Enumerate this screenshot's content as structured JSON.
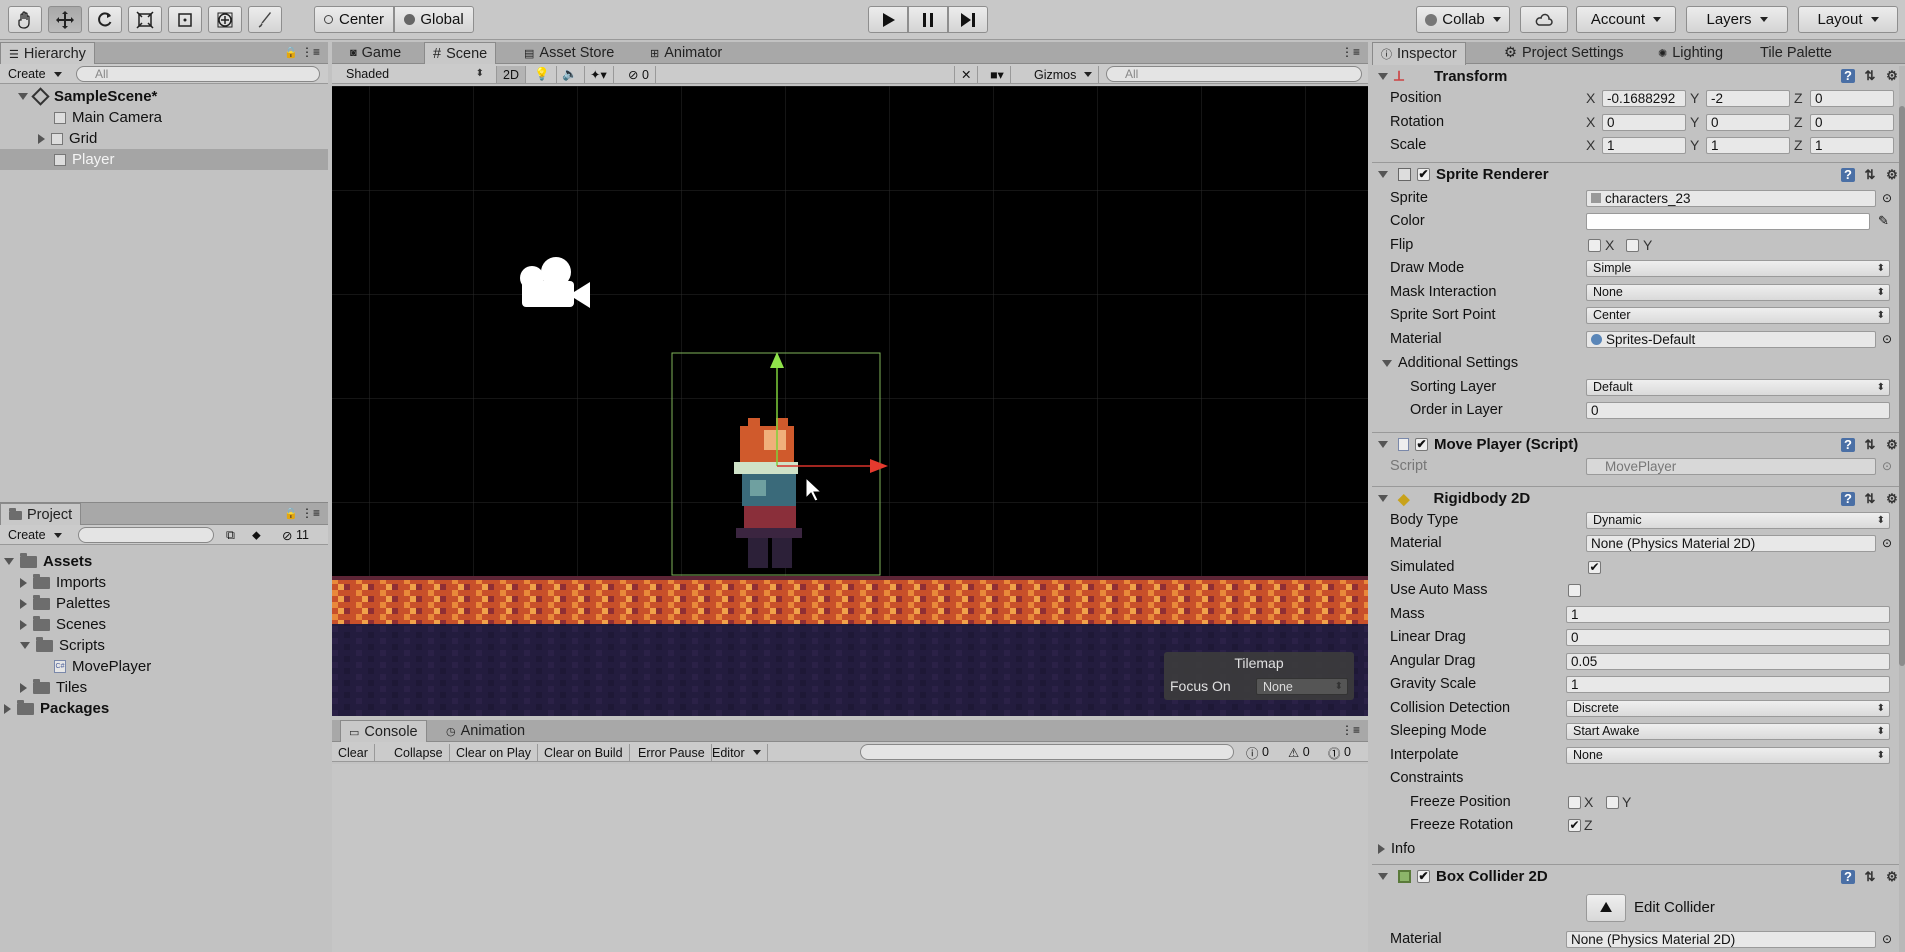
{
  "toolbar": {
    "center_label": "Center",
    "global_label": "Global",
    "collab_label": "Collab",
    "account_label": "Account",
    "layers_label": "Layers",
    "layout_label": "Layout"
  },
  "hierarchy": {
    "tab": "Hierarchy",
    "create": "Create",
    "search_placeholder": "All",
    "scene": "SampleScene*",
    "items": [
      "Main Camera",
      "Grid",
      "Player"
    ]
  },
  "scene_tabs": [
    "Game",
    "Scene",
    "Asset Store",
    "Animator"
  ],
  "scene_toolbar": {
    "shading": "Shaded",
    "mode2d": "2D",
    "hidden_count": "0",
    "gizmos": "Gizmos",
    "search_placeholder": "All"
  },
  "tilemap_overlay": {
    "title": "Tilemap",
    "focus_label": "Focus On",
    "focus_value": "None"
  },
  "project": {
    "tab": "Project",
    "create": "Create",
    "count": "11",
    "root": "Assets",
    "folders": [
      "Imports",
      "Palettes",
      "Scenes",
      "Scripts"
    ],
    "script_file": "MovePlayer",
    "tiles": "Tiles",
    "packages": "Packages"
  },
  "console": {
    "tabs": [
      "Console",
      "Animation"
    ],
    "buttons": [
      "Clear",
      "Collapse",
      "Clear on Play",
      "Clear on Build",
      "Error Pause",
      "Editor"
    ],
    "info_count": "0",
    "warn_count": "0",
    "error_count": "0"
  },
  "inspector": {
    "tabs": [
      "Inspector",
      "Project Settings",
      "Lighting",
      "Tile Palette"
    ],
    "transform": {
      "title": "Transform",
      "position_label": "Position",
      "rotation_label": "Rotation",
      "scale_label": "Scale",
      "position": [
        "-0.1688292",
        "-2",
        "0"
      ],
      "rotation": [
        "0",
        "0",
        "0"
      ],
      "scale": [
        "1",
        "1",
        "1"
      ],
      "axes": [
        "X",
        "Y",
        "Z"
      ]
    },
    "sprite_renderer": {
      "title": "Sprite Renderer",
      "sprite_label": "Sprite",
      "sprite_value": "characters_23",
      "color_label": "Color",
      "flip_label": "Flip",
      "flip_x": "X",
      "flip_y": "Y",
      "draw_mode_label": "Draw Mode",
      "draw_mode": "Simple",
      "mask_label": "Mask Interaction",
      "mask": "None",
      "sort_point_label": "Sprite Sort Point",
      "sort_point": "Center",
      "material_label": "Material",
      "material": "Sprites-Default",
      "additional_label": "Additional Settings",
      "sorting_layer_label": "Sorting Layer",
      "sorting_layer": "Default",
      "order_label": "Order in Layer",
      "order": "0"
    },
    "move_player": {
      "title": "Move Player (Script)",
      "script_label": "Script",
      "script_value": "MovePlayer"
    },
    "rigidbody": {
      "title": "Rigidbody 2D",
      "body_type_label": "Body Type",
      "body_type": "Dynamic",
      "material_label": "Material",
      "material": "None (Physics Material 2D)",
      "simulated_label": "Simulated",
      "auto_mass_label": "Use Auto Mass",
      "mass_label": "Mass",
      "mass": "1",
      "linear_drag_label": "Linear Drag",
      "linear_drag": "0",
      "angular_drag_label": "Angular Drag",
      "angular_drag": "0.05",
      "gravity_label": "Gravity Scale",
      "gravity": "1",
      "collision_label": "Collision Detection",
      "collision": "Discrete",
      "sleeping_label": "Sleeping Mode",
      "sleeping": "Start Awake",
      "interpolate_label": "Interpolate",
      "interpolate": "None",
      "constraints_label": "Constraints",
      "freeze_pos_label": "Freeze Position",
      "freeze_rot_label": "Freeze Rotation",
      "x": "X",
      "y": "Y",
      "z": "Z",
      "info_label": "Info"
    },
    "box_collider": {
      "title": "Box Collider 2D",
      "edit_label": "Edit Collider",
      "material_label": "Material",
      "material": "None (Physics Material 2D)"
    }
  }
}
